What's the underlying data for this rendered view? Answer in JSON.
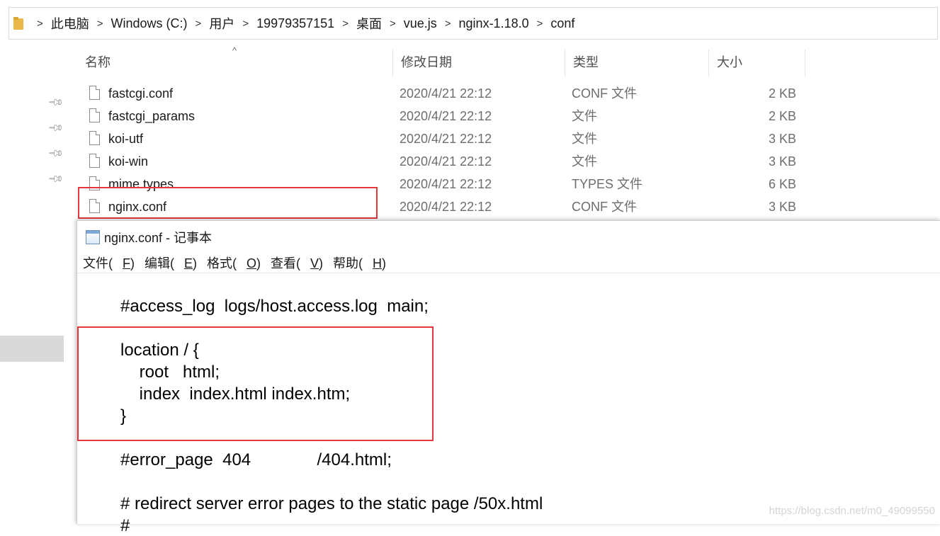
{
  "address_bar": {
    "icon": "folder-icon",
    "crumbs": [
      "此电脑",
      "Windows (C:)",
      "用户",
      "19979357151",
      "桌面",
      "vue.js",
      "nginx-1.18.0",
      "conf"
    ],
    "separator": ">"
  },
  "columns": {
    "name": "名称",
    "date": "修改日期",
    "type": "类型",
    "size": "大小",
    "sort_indicator": "^"
  },
  "pins": [
    "pin-icon",
    "pin-icon",
    "pin-icon",
    "pin-icon"
  ],
  "files": [
    {
      "name": "fastcgi.conf",
      "date": "2020/4/21 22:12",
      "type": "CONF 文件",
      "size": "2 KB"
    },
    {
      "name": "fastcgi_params",
      "date": "2020/4/21 22:12",
      "type": "文件",
      "size": "2 KB"
    },
    {
      "name": "koi-utf",
      "date": "2020/4/21 22:12",
      "type": "文件",
      "size": "3 KB"
    },
    {
      "name": "koi-win",
      "date": "2020/4/21 22:12",
      "type": "文件",
      "size": "3 KB"
    },
    {
      "name": "mime.types",
      "date": "2020/4/21 22:12",
      "type": "TYPES 文件",
      "size": "6 KB"
    },
    {
      "name": "nginx.conf",
      "date": "2020/4/21 22:12",
      "type": "CONF 文件",
      "size": "3 KB"
    }
  ],
  "notepad": {
    "title": "nginx.conf - 记事本",
    "menu": [
      {
        "label": "文件(",
        "key": "F",
        "end": ")"
      },
      {
        "label": "编辑(",
        "key": "E",
        "end": ")"
      },
      {
        "label": "格式(",
        "key": "O",
        "end": ")"
      },
      {
        "label": "查看(",
        "key": "V",
        "end": ")"
      },
      {
        "label": "帮助(",
        "key": "H",
        "end": ")"
      }
    ],
    "lines": [
      "#access_log  logs/host.access.log  main;",
      "location / {",
      "    root   html;",
      "    index  index.html index.htm;",
      "}",
      "#error_page  404              /404.html;",
      "# redirect server error pages to the static page /50x.html",
      "#"
    ]
  },
  "highlight_color": "#e0383b",
  "watermark": "https://blog.csdn.net/m0_49099550"
}
